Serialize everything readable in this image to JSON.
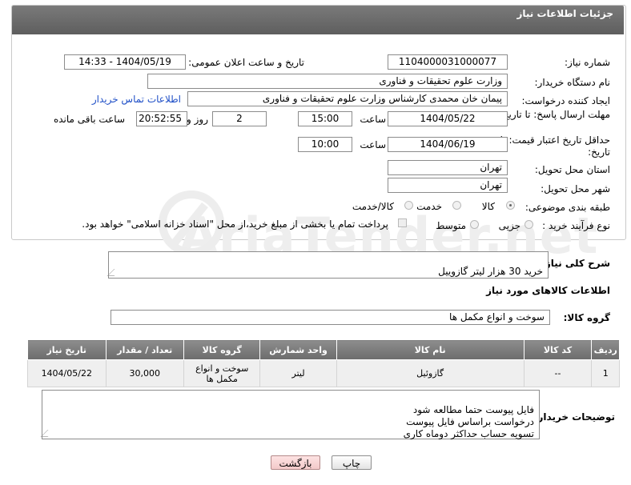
{
  "header": {
    "title": "جزئیات اطلاعات نیاز"
  },
  "watermark": "AriaTender.net",
  "form": {
    "need_number": {
      "label": "شماره نیاز:",
      "value": "1104000031000077"
    },
    "announce_datetime": {
      "label": "تاریخ و ساعت اعلان عمومی:",
      "value": "1404/05/19 - 14:33"
    },
    "buyer_org": {
      "label": "نام دستگاه خریدار:",
      "value": "وزارت علوم  تحقیقات و فناوری"
    },
    "requester": {
      "label": "ایجاد کننده درخواست:",
      "value": "پیمان خان محمدی کارشناس وزارت علوم  تحقیقات و فناوری",
      "contact_link": "اطلاعات تماس خریدار"
    },
    "reply_deadline": {
      "label": "مهلت ارسال پاسخ: تا تاریخ:",
      "date": "1404/05/22",
      "time_label": "ساعت",
      "time": "15:00",
      "days": "2",
      "days_label": "روز و",
      "remaining": "20:52:55",
      "remaining_label": "ساعت باقی مانده"
    },
    "price_validity": {
      "label": "حداقل تاریخ اعتبار قیمت: تا تاریخ:",
      "date": "1404/06/19",
      "time_label": "ساعت",
      "time": "10:00"
    },
    "delivery_province": {
      "label": "استان محل تحویل:",
      "value": "تهران"
    },
    "delivery_city": {
      "label": "شهر محل تحویل:",
      "value": "تهران"
    },
    "category": {
      "label": "طبقه بندی موضوعی:",
      "options": [
        "کالا",
        "خدمت",
        "کالا/خدمت"
      ],
      "selected": "کالا"
    },
    "process_type": {
      "label": "نوع فرآیند خرید :",
      "options": [
        "جزیی",
        "متوسط"
      ],
      "selected": "",
      "payment_note": "پرداخت تمام یا بخشی از مبلغ خرید،از محل \"اسناد خزانه اسلامی\" خواهد بود."
    }
  },
  "description": {
    "label": "شرح کلی نیاز:",
    "value": "خرید 30 هزار لیتر گازوییل"
  },
  "goods_section": {
    "title": "اطلاعات کالاهای مورد نیاز"
  },
  "goods_group": {
    "label": "گروه کالا:",
    "value": "سوخت و انواع مکمل ها"
  },
  "table": {
    "headers": [
      "ردیف",
      "کد کالا",
      "نام کالا",
      "واحد شمارش",
      "گروه کالا",
      "تعداد / مقدار",
      "تاریخ نیاز"
    ],
    "rows": [
      [
        "1",
        "--",
        "گازوئیل",
        "لیتر",
        "سوخت و انواع مکمل ها",
        "30,000",
        "1404/05/22"
      ]
    ]
  },
  "buyer_notes": {
    "label": "توضیحات خریدار:",
    "value": "فایل پیوست حتما مطالعه شود\nدرخواست براساس فایل پیوست\nتسویه حساب حداکثر دوماه کاری"
  },
  "buttons": {
    "print": "چاپ",
    "back": "بازگشت"
  }
}
